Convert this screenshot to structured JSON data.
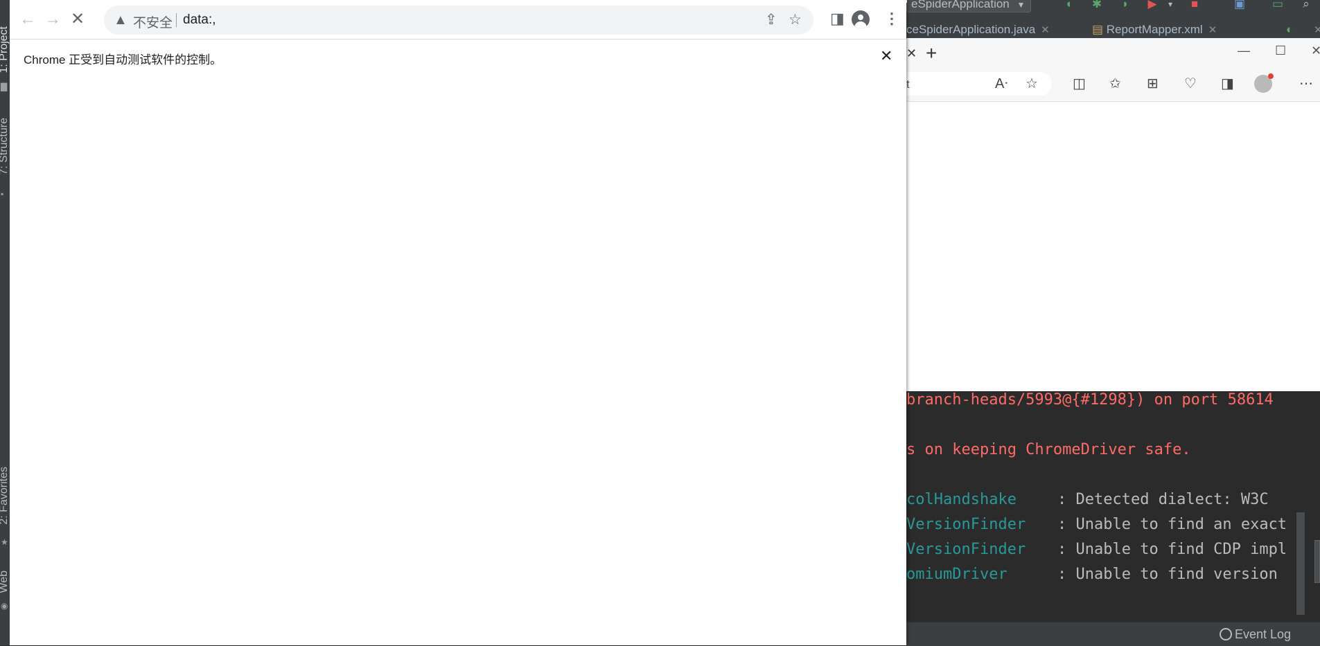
{
  "ide": {
    "left_tabs": [
      {
        "label": "1: Project",
        "active": true
      },
      {
        "label": "7: Structure",
        "active": false
      },
      {
        "label": "2: Favorites",
        "active": false
      },
      {
        "label": "Web",
        "active": false
      }
    ],
    "run_config_label": "eSpiderApplication",
    "editor_tabs": [
      {
        "label": "ceSpiderApplication.java"
      },
      {
        "label": "ReportMapper.xml"
      }
    ],
    "console_lines": [
      {
        "text": "branch-heads/5993@{#1298}) on port 58614",
        "style": "err"
      },
      {
        "text": "s on keeping ChromeDriver safe.",
        "style": "err"
      },
      {
        "logger": "colHandshake",
        "message": ": Detected dialect: W3C"
      },
      {
        "logger": "VersionFinder",
        "message": ": Unable to find an exact"
      },
      {
        "logger": "VersionFinder",
        "message": ": Unable to find CDP impl"
      },
      {
        "logger": "omiumDriver",
        "message": ": Unable to find version"
      }
    ],
    "status": {
      "event_log": "Event Log"
    },
    "colors": {
      "background": "#2b2b2b",
      "error": "#ff6b68",
      "logger": "#299999",
      "text": "#bbbbbb"
    }
  },
  "edge": {
    "address_tail": "t",
    "icons": [
      "read-aloud-icon",
      "favorite-star-icon",
      "split-screen-icon",
      "favorites-icon",
      "collections-icon",
      "browser-essentials-icon",
      "sidebar-icon",
      "profile-icon",
      "more-icon"
    ]
  },
  "chrome": {
    "omnibox": {
      "security_label": "不安全",
      "url": "data:,"
    },
    "infobar": {
      "message": "Chrome 正受到自动测试软件的控制。"
    },
    "icons": {
      "back": "back-arrow-icon",
      "forward": "forward-arrow-icon",
      "stop": "stop-loading-icon",
      "share": "share-icon",
      "bookmark": "bookmark-star-icon",
      "side_panel": "side-panel-icon",
      "profile": "profile-icon",
      "menu": "menu-kebab-icon"
    }
  }
}
